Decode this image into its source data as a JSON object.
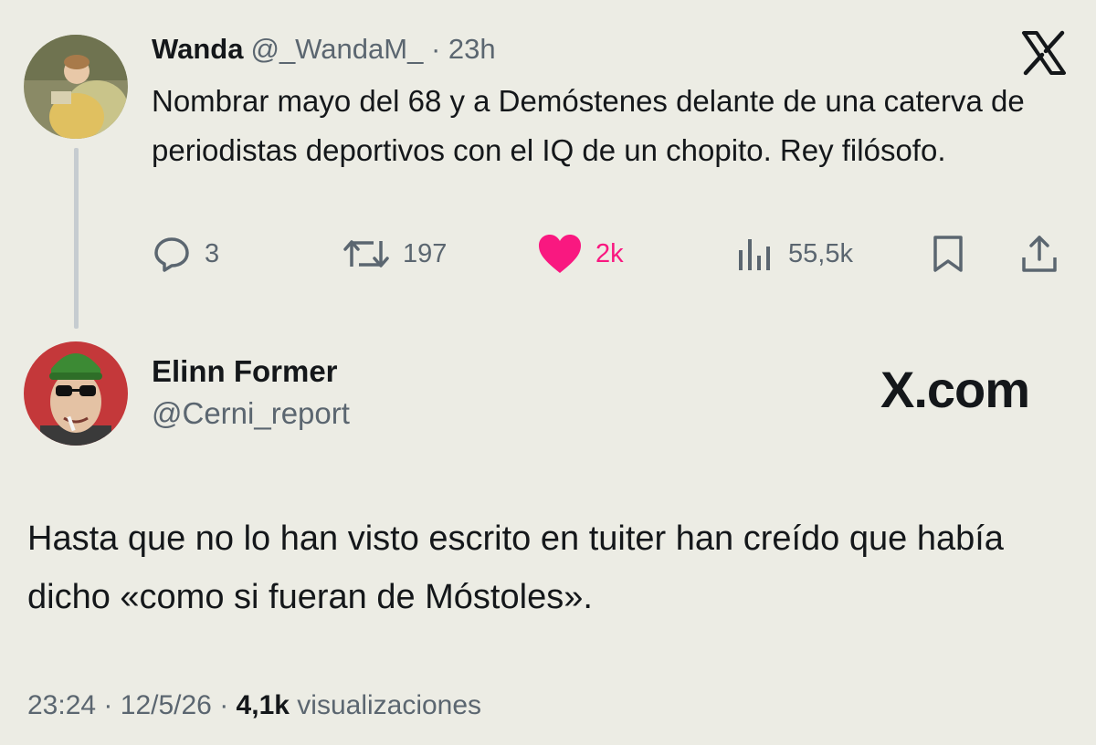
{
  "quoted_post": {
    "author_name": "Wanda",
    "author_handle": "@_WandaM_",
    "separator": "·",
    "time_ago": "23h",
    "text": "Nombrar mayo del 68 y a Demóstenes delante de una caterva de periodistas deportivos con el IQ de un chopito. Rey filósofo.",
    "reply_count": "3",
    "repost_count": "197",
    "like_count": "2k",
    "view_count": "55,5k",
    "like_color": "#f91880"
  },
  "reply_post": {
    "author_name": "Elinn Former",
    "author_handle": "@Cerni_report",
    "site_label": "X.com",
    "text": "Hasta que no lo han visto escrito en tuiter han creído que había dicho «como si fueran de Móstoles».",
    "time": "23:24",
    "date": "12/5/26",
    "views_count": "4,1k",
    "views_label": "visualizaciones",
    "separator": "·"
  },
  "icons": [
    "x-logo-icon",
    "reply-icon",
    "repost-icon",
    "heart-icon",
    "views-icon",
    "bookmark-icon",
    "share-icon"
  ]
}
